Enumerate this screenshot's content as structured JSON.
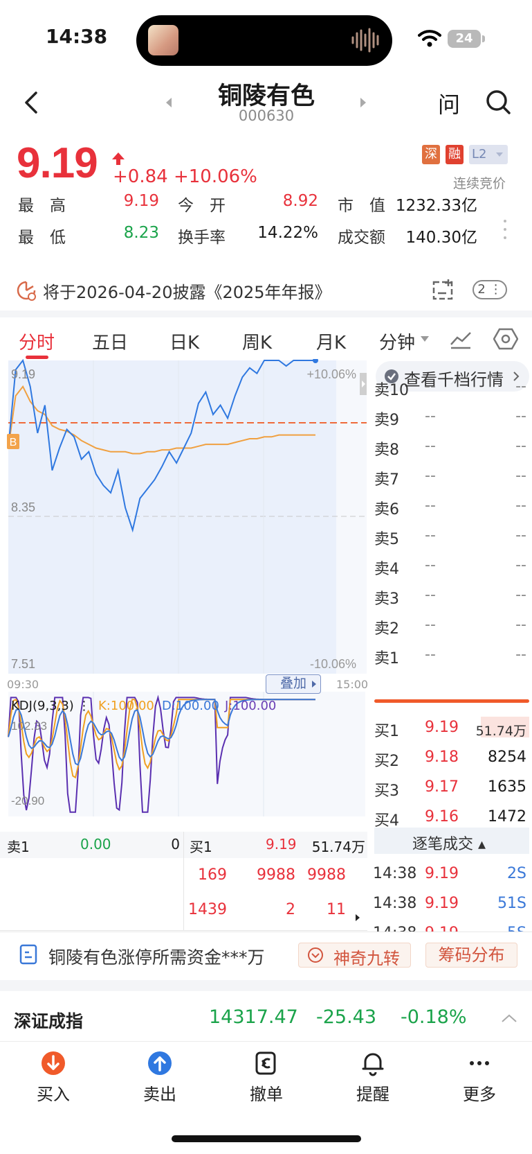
{
  "status_bar": {
    "time": "14:38",
    "battery": "24"
  },
  "header": {
    "title": "铜陵有色",
    "code": "000630",
    "ask_label": "问"
  },
  "quote": {
    "price": "9.19",
    "change": "+0.84",
    "change_pct": "+10.06%",
    "tags": [
      "深",
      "融",
      "L2"
    ],
    "auction_label": "连续竞价",
    "colors": {
      "up": "#e8313b",
      "down": "#1aa34a"
    }
  },
  "stats": [
    {
      "label": "最　高",
      "value": "9.19"
    },
    {
      "label": "今　开",
      "value": "8.92"
    },
    {
      "label": "市　值",
      "value": "1232.33亿"
    },
    {
      "label": "最　低",
      "value": "8.23"
    },
    {
      "label": "换手率",
      "value": "14.22%"
    },
    {
      "label": "成交额",
      "value": "140.30亿"
    }
  ],
  "notice": {
    "text": "将于2026-04-20披露《2025年年报》",
    "count": "2"
  },
  "tabs": [
    "分时",
    "五日",
    "日K",
    "周K",
    "月K",
    "分钟"
  ],
  "chart": {
    "price_top": "9.19",
    "price_mid": "8.35",
    "price_bottom": "7.51",
    "pct_top": "+10.06%",
    "pct_bottom": "-10.06%",
    "time_start": "09:30",
    "time_end": "15:00",
    "overlay_label": "叠加",
    "marker_label": "B",
    "kdj": {
      "title": "KDJ(9,3,3)",
      "k": "K:100.00",
      "d": "D:100.00",
      "j": "J:100.00",
      "top": "102.33",
      "bottom": "-20.90"
    }
  },
  "chart_data": {
    "type": "line",
    "title": "",
    "series": [
      {
        "values": [
          8.72,
          9.14,
          9.19,
          9.05,
          8.8,
          8.95,
          8.6,
          8.72,
          8.82,
          8.78,
          8.66,
          8.7,
          8.58,
          8.52,
          8.48,
          8.6,
          8.4,
          8.28,
          8.45,
          8.5,
          8.55,
          8.62,
          8.7,
          8.64,
          8.72,
          8.8,
          8.96,
          9.02,
          8.9,
          8.95,
          8.88,
          9.0,
          9.1,
          9.15,
          9.12,
          9.19,
          9.19,
          9.19,
          9.16,
          9.19,
          9.19,
          9.19,
          9.19
        ]
      },
      {
        "values": [
          8.72,
          9.0,
          9.05,
          8.97,
          8.92,
          8.9,
          8.84,
          8.82,
          8.81,
          8.79,
          8.76,
          8.74,
          8.72,
          8.71,
          8.7,
          8.7,
          8.7,
          8.69,
          8.69,
          8.7,
          8.7,
          8.71,
          8.71,
          8.72,
          8.72,
          8.72,
          8.73,
          8.74,
          8.74,
          8.74,
          8.74,
          8.75,
          8.76,
          8.77,
          8.77,
          8.78,
          8.78,
          8.79,
          8.79,
          8.79,
          8.79,
          8.79,
          8.79
        ]
      }
    ],
    "ylim": [
      7.51,
      9.19
    ],
    "prev_close": 8.35
  },
  "depth": {
    "button_label": "查看千档行情",
    "asks": [
      {
        "label": "卖10",
        "price": "--",
        "vol": "--"
      },
      {
        "label": "卖9",
        "price": "--",
        "vol": "--"
      },
      {
        "label": "卖8",
        "price": "--",
        "vol": "--"
      },
      {
        "label": "卖7",
        "price": "--",
        "vol": "--"
      },
      {
        "label": "卖6",
        "price": "--",
        "vol": "--"
      },
      {
        "label": "卖5",
        "price": "--",
        "vol": "--"
      },
      {
        "label": "卖4",
        "price": "--",
        "vol": "--"
      },
      {
        "label": "卖3",
        "price": "--",
        "vol": "--"
      },
      {
        "label": "卖2",
        "price": "--",
        "vol": "--"
      },
      {
        "label": "卖1",
        "price": "--",
        "vol": "--"
      }
    ],
    "bids": [
      {
        "label": "买1",
        "price": "9.19",
        "vol": "51.74万"
      },
      {
        "label": "买2",
        "price": "9.18",
        "vol": "8254"
      },
      {
        "label": "买3",
        "price": "9.17",
        "vol": "1635"
      },
      {
        "label": "买4",
        "price": "9.16",
        "vol": "1472"
      }
    ]
  },
  "ticks": {
    "header": "逐笔成交",
    "rows": [
      {
        "time": "14:38",
        "price": "9.19",
        "vol": "2S"
      },
      {
        "time": "14:38",
        "price": "9.19",
        "vol": "51S"
      },
      {
        "time": "14:38",
        "price": "9.19",
        "vol": "5S"
      }
    ]
  },
  "level1": {
    "sell_label": "卖1",
    "sell_price": "0.00",
    "sell_vol": "0",
    "buy_label": "买1",
    "buy_price": "9.19",
    "buy_vol": "51.74万",
    "rows": [
      [
        "169",
        "9988",
        "9988"
      ],
      [
        "1439",
        "2",
        "11"
      ]
    ]
  },
  "capital": {
    "text": "铜陵有色涨停所需资金***万",
    "nine_turn": "神奇九转",
    "chip": "筹码分布"
  },
  "index_strip": {
    "name": "深证成指",
    "value": "14317.47",
    "change": "-25.43",
    "pct": "-0.18%"
  },
  "toolbar": [
    {
      "label": "买入",
      "icon": "buy-icon"
    },
    {
      "label": "卖出",
      "icon": "sell-icon"
    },
    {
      "label": "撤单",
      "icon": "cancel-order-icon"
    },
    {
      "label": "提醒",
      "icon": "bell-icon"
    },
    {
      "label": "更多",
      "icon": "more-icon"
    }
  ]
}
